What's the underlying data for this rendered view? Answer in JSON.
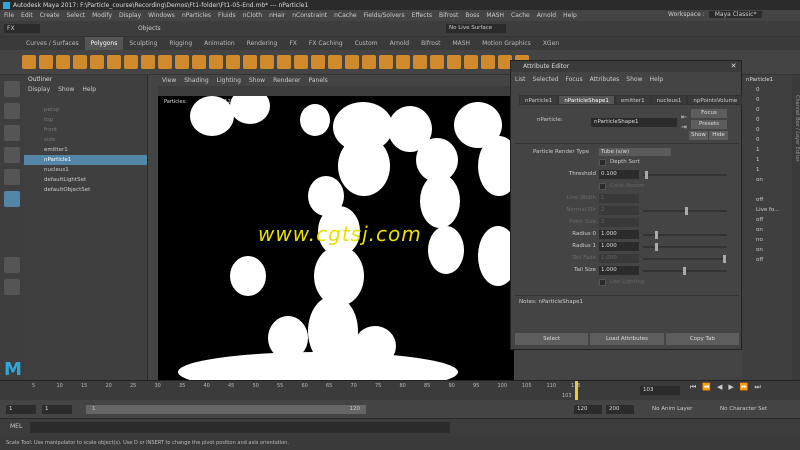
{
  "window": {
    "title": "Autodesk Maya 2017: F:\\Particle_course\\Recording\\Demos\\Ft1-folder\\Ft1-05-End.mb*   ---   nParticle1",
    "workspace_label": "Workspace :",
    "workspace_value": "Maya Classic*"
  },
  "menubar": [
    "File",
    "Edit",
    "Create",
    "Select",
    "Modify",
    "Display",
    "Windows",
    "nParticles",
    "Fluids",
    "nCloth",
    "nHair",
    "nConstraint",
    "nCache",
    "Fields/Solvers",
    "Effects",
    "Bifrost",
    "Boss",
    "MASH",
    "Cache",
    "Arnold",
    "Help"
  ],
  "statusline": {
    "menu_set": "FX",
    "objects_label": "Objects",
    "live_surface": "No Live Surface"
  },
  "shelf_tabs": [
    "Curves / Surfaces",
    "Polygons",
    "Sculpting",
    "Rigging",
    "Animation",
    "Rendering",
    "FX",
    "FX Caching",
    "Custom",
    "Arnold",
    "Bifrost",
    "MASH",
    "Motion Graphics",
    "XGen"
  ],
  "shelf_active": "Polygons",
  "outliner": {
    "title": "Outliner",
    "menu": [
      "Display",
      "Show",
      "Help"
    ],
    "items": [
      {
        "label": "persp",
        "state": "dim"
      },
      {
        "label": "top",
        "state": "dim"
      },
      {
        "label": "front",
        "state": "dim"
      },
      {
        "label": "side",
        "state": "dim"
      },
      {
        "label": "emitter1",
        "state": "normal"
      },
      {
        "label": "nParticle1",
        "state": "selected"
      },
      {
        "label": "nucleus1",
        "state": "normal"
      },
      {
        "label": "defaultLightSet",
        "state": "normal"
      },
      {
        "label": "defaultObjectSet",
        "state": "normal"
      }
    ]
  },
  "viewport": {
    "menu": [
      "View",
      "Shading",
      "Lighting",
      "Show",
      "Renderer",
      "Panels"
    ],
    "readout_label": "Particles:",
    "readout_value_1": "127",
    "readout_value_2": "127",
    "watermark": "www.cgtsj.com"
  },
  "attribute_editor": {
    "title": "Attribute Editor",
    "menu": [
      "List",
      "Selected",
      "Focus",
      "Attributes",
      "Show",
      "Help"
    ],
    "tabs": [
      "nParticle1",
      "nParticleShape1",
      "emitter1",
      "nucleus1",
      "npPointsVolume"
    ],
    "active_tab": "nParticleShape1",
    "node_label": "nParticle:",
    "node_value": "nParticleShape1",
    "focus_btn": "Focus",
    "presets_btn": "Presets",
    "show_btn": "Show",
    "hide_btn": "Hide",
    "render_type_label": "Particle Render Type",
    "render_type_value": "Tube (s/w)",
    "depth_sort": "Depth Sort",
    "threshold_label": "Threshold",
    "threshold_value": "0.100",
    "color_accum": "Color Accum",
    "line_width_label": "Line Width",
    "line_width_value": "1",
    "normal_dir_label": "Normal Dir",
    "normal_dir_value": "2",
    "point_size_label": "Point Size",
    "point_size_value": "2",
    "radius0_label": "Radius 0",
    "radius0_value": "1.000",
    "radius1_label": "Radius 1",
    "radius1_value": "1.000",
    "tail_fade_label": "Tail Fade",
    "tail_fade_value": "1.000",
    "tail_size_label": "Tail Size",
    "tail_size_value": "1.000",
    "use_lighting": "Use Lighting",
    "notes": "Notes:  nParticleShape1",
    "select_btn": "Select",
    "load_btn": "Load Attributes",
    "copy_btn": "Copy Tab"
  },
  "channelbox": {
    "side_label": "Channel Box / Layer Editor",
    "header": "nParticle1",
    "rows": [
      "0",
      "0",
      "0",
      "0",
      "0",
      "0",
      "1",
      "1",
      "1",
      "on",
      "",
      "off",
      "Live fo...",
      "off",
      "on",
      "no",
      "on",
      "off"
    ]
  },
  "timeline": {
    "ticks": [
      "5",
      "10",
      "15",
      "20",
      "25",
      "30",
      "35",
      "40",
      "45",
      "50",
      "55",
      "60",
      "65",
      "70",
      "75",
      "80",
      "85",
      "90",
      "95",
      "100",
      "105",
      "110",
      "115"
    ],
    "current_frame": "103",
    "current_marker_label": "103"
  },
  "range": {
    "start": "1",
    "start_inner": "1",
    "range_start": "1",
    "range_end": "120",
    "end_inner": "120",
    "end": "200",
    "anim_layer": "No Anim Layer",
    "char_set": "No Character Set"
  },
  "mel": {
    "label": "MEL"
  },
  "help_line": "Scale Tool: Use manipulator to scale object(s). Use D or INSERT to change the pivot position and axis orientation."
}
